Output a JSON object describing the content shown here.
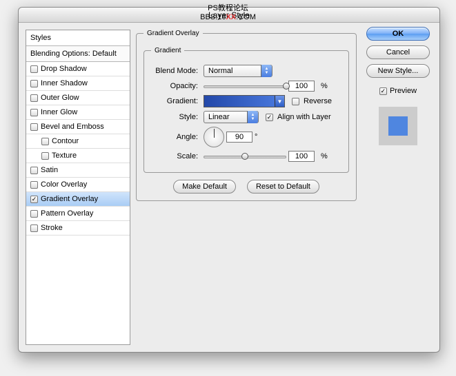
{
  "watermark": {
    "line1": "PS教程论坛",
    "line2_a": "BBS.16",
    "line2_x": "XX",
    "line2_b": ".COM"
  },
  "window": {
    "title": "Layer Style"
  },
  "sidebar": {
    "header": "Styles",
    "blending": "Blending Options: Default",
    "items": [
      {
        "label": "Drop Shadow",
        "checked": false,
        "indent": 0
      },
      {
        "label": "Inner Shadow",
        "checked": false,
        "indent": 0
      },
      {
        "label": "Outer Glow",
        "checked": false,
        "indent": 0
      },
      {
        "label": "Inner Glow",
        "checked": false,
        "indent": 0
      },
      {
        "label": "Bevel and Emboss",
        "checked": false,
        "indent": 0
      },
      {
        "label": "Contour",
        "checked": false,
        "indent": 1
      },
      {
        "label": "Texture",
        "checked": false,
        "indent": 1
      },
      {
        "label": "Satin",
        "checked": false,
        "indent": 0
      },
      {
        "label": "Color Overlay",
        "checked": false,
        "indent": 0
      },
      {
        "label": "Gradient Overlay",
        "checked": true,
        "indent": 0,
        "selected": true
      },
      {
        "label": "Pattern Overlay",
        "checked": false,
        "indent": 0
      },
      {
        "label": "Stroke",
        "checked": false,
        "indent": 0
      }
    ]
  },
  "panel": {
    "title": "Gradient Overlay",
    "gradient_legend": "Gradient",
    "blend_mode_label": "Blend Mode:",
    "blend_mode_value": "Normal",
    "opacity_label": "Opacity:",
    "opacity_value": "100",
    "opacity_unit": "%",
    "gradient_label": "Gradient:",
    "reverse_label": "Reverse",
    "style_label": "Style:",
    "style_value": "Linear",
    "align_label": "Align with Layer",
    "angle_label": "Angle:",
    "angle_value": "90",
    "angle_unit": "°",
    "scale_label": "Scale:",
    "scale_value": "100",
    "scale_unit": "%",
    "make_default": "Make Default",
    "reset_default": "Reset to Default"
  },
  "right": {
    "ok": "OK",
    "cancel": "Cancel",
    "new_style": "New Style...",
    "preview": "Preview",
    "preview_checked": true,
    "swatch_color": "#4f86e0"
  }
}
